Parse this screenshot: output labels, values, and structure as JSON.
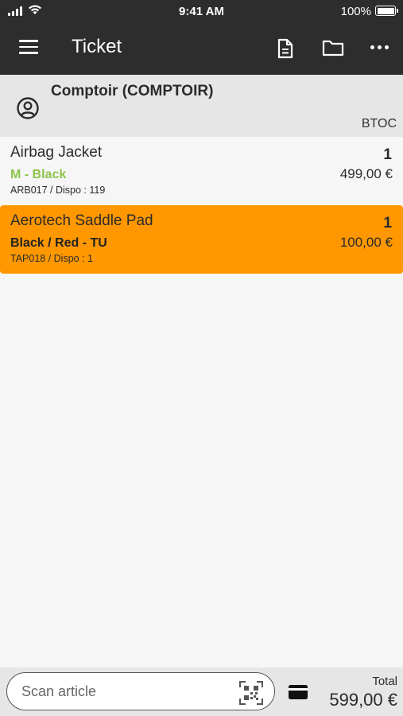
{
  "status_bar": {
    "time": "9:41 AM",
    "battery": "100%"
  },
  "app_bar": {
    "title": "Ticket"
  },
  "customer": {
    "name": "Comptoir (COMPTOIR)",
    "segment": "BTOC"
  },
  "lines": [
    {
      "name": "Airbag Jacket",
      "variant": "M - Black",
      "ref": "ARB017 / Dispo : 119",
      "qty": "1",
      "price": "499,00 €"
    },
    {
      "name": "Aerotech Saddle Pad",
      "variant": "Black / Red - TU",
      "ref": "TAP018 / Dispo : 1",
      "qty": "1",
      "price": "100,00 €"
    }
  ],
  "bottom_bar": {
    "scan_placeholder": "Scan article",
    "total_label": "Total",
    "total_value": "599,00 €"
  },
  "colors": {
    "app_bar": "#2d2d2d",
    "selected_line": "#ff9800",
    "variant_green": "#8cc34a",
    "customer_bg": "#e6e6e6"
  },
  "icons": [
    "signal-icon",
    "wifi-icon",
    "battery-icon",
    "menu-icon",
    "document-icon",
    "folder-icon",
    "more-icon",
    "user-circle-icon",
    "qr-code-icon",
    "credit-card-icon"
  ]
}
